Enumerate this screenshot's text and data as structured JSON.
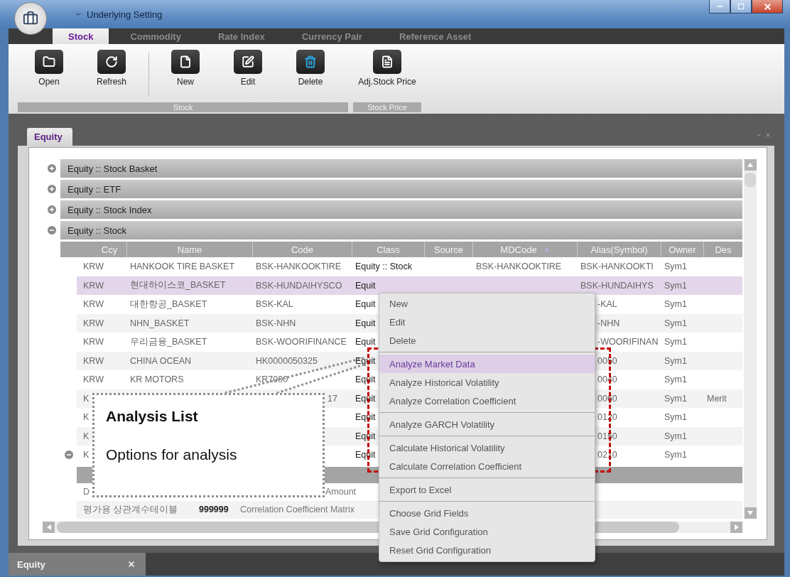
{
  "window": {
    "title": "Underlying Setting"
  },
  "ribbon_tabs": [
    {
      "label": "Stock",
      "selected": true
    },
    {
      "label": "Commodity",
      "selected": false
    },
    {
      "label": "Rate Index",
      "selected": false
    },
    {
      "label": "Currency Pair",
      "selected": false
    },
    {
      "label": "Reference Asset",
      "selected": false
    }
  ],
  "ribbon_groups": [
    {
      "label": "Stock",
      "buttons": [
        {
          "kind": "open",
          "label": "Open",
          "divider_before": false
        },
        {
          "kind": "refresh",
          "label": "Refresh",
          "divider_before": false
        },
        {
          "kind": "new",
          "label": "New",
          "divider_before": true
        },
        {
          "kind": "edit",
          "label": "Edit",
          "divider_before": false
        },
        {
          "kind": "delete",
          "label": "Delete",
          "divider_before": false
        }
      ]
    },
    {
      "label": "Stock Price",
      "buttons": [
        {
          "kind": "document",
          "label": "Adj.Stock Price",
          "divider_before": false
        }
      ]
    }
  ],
  "document_tab": {
    "label": "Equity"
  },
  "groups": [
    {
      "label": "Equity :: Stock Basket",
      "expanded": false
    },
    {
      "label": "Equity :: ETF",
      "expanded": false
    },
    {
      "label": "Equity :: Stock Index",
      "expanded": false
    },
    {
      "label": "Equity :: Stock",
      "expanded": true
    }
  ],
  "grid": {
    "columns": [
      {
        "label": "Ccy"
      },
      {
        "label": "Name"
      },
      {
        "label": "Code"
      },
      {
        "label": "Class"
      },
      {
        "label": "Source"
      },
      {
        "label": "MDCode",
        "sorted": true
      },
      {
        "label": "Alias(Symbol)"
      },
      {
        "label": "Owner"
      },
      {
        "label": "Des"
      }
    ],
    "rows": [
      {
        "selected": false,
        "expanded": false,
        "cells": [
          "KRW",
          "HANKOOK TIRE BASKET",
          "BSK-HANKOOKTIRE",
          "Equity :: Stock",
          null,
          "BSK-HANKOOKTIRE",
          "BSK-HANKOOKTI",
          "Sym1",
          null
        ]
      },
      {
        "selected": true,
        "expanded": false,
        "cells": [
          "KRW",
          "현대하이스코_BASKET",
          "BSK-HUNDAIHYSCO",
          "Equit",
          null,
          null,
          "BSK-HUNDAIHYS",
          "Sym1",
          null
        ]
      },
      {
        "selected": false,
        "expanded": false,
        "cells": [
          "KRW",
          "대한항공_BASKET",
          "BSK-KAL",
          "Equit",
          null,
          null,
          "-KAL",
          "Sym1",
          null
        ]
      },
      {
        "selected": false,
        "expanded": false,
        "cells": [
          "KRW",
          "NHN_BASKET",
          "BSK-NHN",
          "Equit",
          null,
          null,
          "-NHN",
          "Sym1",
          null
        ]
      },
      {
        "selected": false,
        "expanded": false,
        "cells": [
          "KRW",
          "우리금융_BASKET",
          "BSK-WOORIFINANCE",
          "Equit",
          null,
          null,
          "-WOORIFINAN",
          "Sym1",
          null
        ]
      },
      {
        "selected": false,
        "expanded": false,
        "cells": [
          "KRW",
          "CHINA OCEAN",
          "HK0000050325",
          "Equit",
          null,
          null,
          "0050",
          "Sym1",
          null
        ]
      },
      {
        "selected": false,
        "expanded": false,
        "cells": [
          "KRW",
          "KR MOTORS",
          "KR7000",
          "Equit",
          null,
          null,
          "0040",
          "Sym1",
          null
        ]
      },
      {
        "selected": false,
        "expanded": false,
        "cells": [
          "K",
          null,
          "17",
          "Equit",
          null,
          null,
          "0060",
          "Sym1",
          "Merit"
        ]
      },
      {
        "selected": false,
        "expanded": false,
        "cells": [
          "K",
          null,
          null,
          "Equit",
          null,
          null,
          "0120",
          "Sym1",
          null
        ]
      },
      {
        "selected": false,
        "expanded": false,
        "cells": [
          "K",
          null,
          null,
          "Equit",
          null,
          null,
          "0150",
          "Sym1",
          null
        ]
      },
      {
        "selected": false,
        "expanded": true,
        "cells": [
          "K",
          null,
          null,
          "Equit",
          null,
          null,
          "0210",
          "Sym1",
          null
        ]
      }
    ],
    "detail_rows": [
      {
        "cells": [
          "D",
          null,
          null,
          "Amount"
        ]
      },
      {
        "cells": [
          "평가용 상관계수테이블",
          "999999",
          "Correlation Coefficient Matrix",
          null
        ]
      }
    ]
  },
  "context_menu": [
    {
      "kind": "item",
      "label": "New",
      "selected": false
    },
    {
      "kind": "item",
      "label": "Edit",
      "selected": false
    },
    {
      "kind": "item",
      "label": "Delete",
      "selected": false
    },
    {
      "kind": "separator"
    },
    {
      "kind": "item",
      "label": "Analyze Market Data",
      "selected": true
    },
    {
      "kind": "item",
      "label": "Analyze Historical Volatility",
      "selected": false
    },
    {
      "kind": "item",
      "label": "Analyze Correlation Coefficient",
      "selected": false
    },
    {
      "kind": "separator"
    },
    {
      "kind": "item",
      "label": "Analyze GARCH Volatility",
      "selected": false
    },
    {
      "kind": "separator"
    },
    {
      "kind": "item",
      "label": "Calculate Historical Volatility",
      "selected": false
    },
    {
      "kind": "item",
      "label": "Calculate Correlation Coefficient",
      "selected": false
    },
    {
      "kind": "separator"
    },
    {
      "kind": "item",
      "label": "Export to Excel",
      "selected": false
    },
    {
      "kind": "separator"
    },
    {
      "kind": "item",
      "label": "Choose Grid Fields",
      "selected": false
    },
    {
      "kind": "item",
      "label": "Save Grid Configuration",
      "selected": false
    },
    {
      "kind": "item",
      "label": "Reset Grid Configuration",
      "selected": false
    }
  ],
  "callout": {
    "title": "Analysis List",
    "text": "Options for analysis"
  },
  "bottom_tabs": [
    {
      "label": "Equity"
    }
  ]
}
